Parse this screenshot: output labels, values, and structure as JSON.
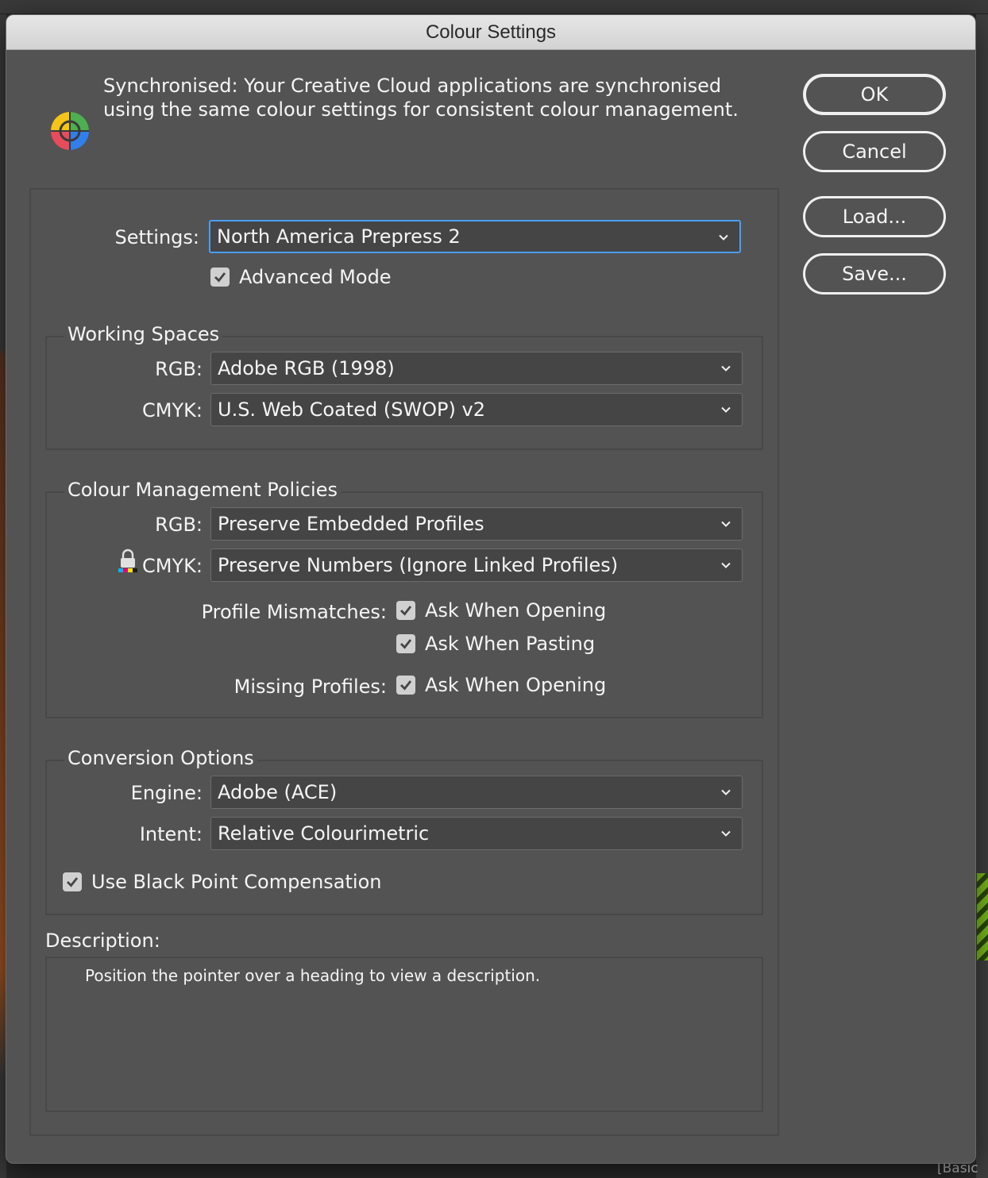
{
  "dialog": {
    "title": "Colour Settings",
    "sync_message": "Synchronised: Your Creative Cloud applications are synchronised using the same colour settings for consistent colour management."
  },
  "buttons": {
    "ok": "OK",
    "cancel": "Cancel",
    "load": "Load...",
    "save": "Save..."
  },
  "settings": {
    "label": "Settings:",
    "value": "North America Prepress 2",
    "advanced_mode_label": "Advanced Mode",
    "advanced_mode_checked": true
  },
  "working_spaces": {
    "title": "Working Spaces",
    "rgb_label": "RGB:",
    "rgb_value": "Adobe RGB (1998)",
    "cmyk_label": "CMYK:",
    "cmyk_value": "U.S. Web Coated (SWOP) v2"
  },
  "policies": {
    "title": "Colour Management Policies",
    "rgb_label": "RGB:",
    "rgb_value": "Preserve Embedded Profiles",
    "cmyk_label": "CMYK:",
    "cmyk_value": "Preserve Numbers (Ignore Linked Profiles)",
    "profile_mismatches_label": "Profile Mismatches:",
    "ask_when_opening_label": "Ask When Opening",
    "ask_when_pasting_label": "Ask When Pasting",
    "missing_profiles_label": "Missing Profiles:",
    "missing_ask_when_opening_label": "Ask When Opening"
  },
  "conversion": {
    "title": "Conversion Options",
    "engine_label": "Engine:",
    "engine_value": "Adobe (ACE)",
    "intent_label": "Intent:",
    "intent_value": "Relative Colourimetric",
    "black_point_label": "Use Black Point Compensation"
  },
  "description": {
    "label": "Description:",
    "text": "Position the pointer over a heading to view a description."
  },
  "background": {
    "footer_label": "[Basic"
  },
  "colors": {
    "dialog_bg": "#535353",
    "accent": "#4a9ff5",
    "field_bg": "#454545"
  }
}
